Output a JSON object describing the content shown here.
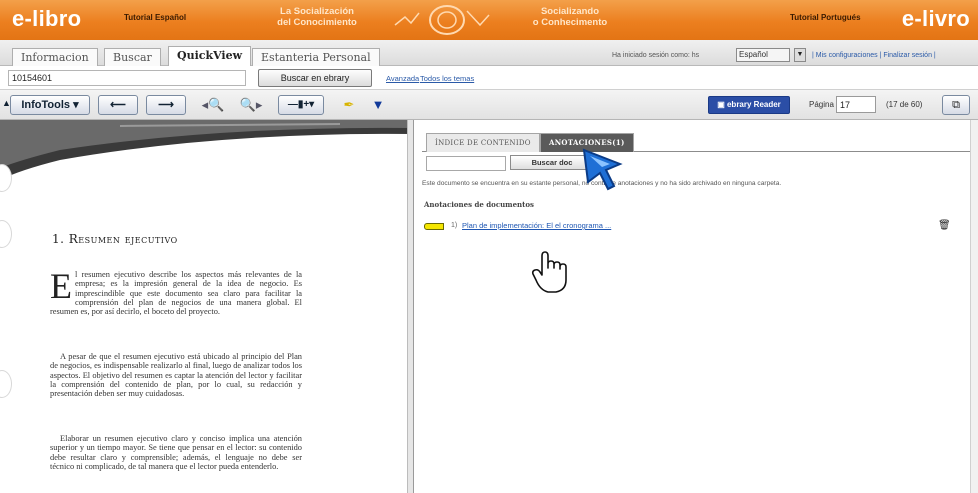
{
  "banner": {
    "brand_left": "e-libro",
    "tutorial_es": "Tutorial Español",
    "slogan_es_line1": "La Socialización",
    "slogan_es_line2": "del Conocimiento",
    "slogan_pt_line1": "Socializando",
    "slogan_pt_line2": "o Conhecimento",
    "tutorial_pt": "Tutorial Portugués",
    "brand_right": "e-livro"
  },
  "tabs": [
    {
      "label": "Informacion"
    },
    {
      "label": "Buscar"
    },
    {
      "label": "QuickView",
      "active": true
    },
    {
      "label": "Estanteria Personal"
    }
  ],
  "session": {
    "text": "Ha iniciado sesión como: hs",
    "language": "Español",
    "links": "| Mis configuraciones | Finalizar sesión |"
  },
  "search": {
    "value": "10154601",
    "button": "Buscar en ebrary",
    "advanced": "Avanzada",
    "all_topics": "Todos los temas"
  },
  "toolbar": {
    "infotools": "InfoTools",
    "reader": "ebrary Reader",
    "page_label": "Página",
    "page_value": "17",
    "page_count": "(17 de 60)"
  },
  "document": {
    "heading": "1. Resumen ejecutivo",
    "dropcap": "E",
    "p1": "l resumen ejecutivo describe los aspectos más relevantes de la empresa; es la impresión general de la idea de negocio. Es imprescindible que este documento sea claro para facilitar la comprensión del plan de negocios de una manera global. El resumen es, por así decirlo, el boceto del proyecto.",
    "p2": "A pesar de que el resumen ejecutivo está ubicado al principio del Plan de negocios, es indispensable realizarlo al final, luego de analizar todos los aspectos. El objetivo del resumen es captar la atención del lector y facilitar la comprensión del contenido de plan, por lo cual, su redacción y presentación deben ser muy cuidadosas.",
    "p3": "Elaborar un resumen ejecutivo claro y conciso implica una atención superior y un tiempo mayor. Se tiene que pensar en el lector: su contenido debe resultar claro y comprensible; además, el lenguaje no debe ser técnico ni complicado, de tal manera que el lector pueda entenderlo."
  },
  "annotations": {
    "tab_index": "ÍNDICE DE CONTENIDO",
    "tab_annotations": "ANOTACIONES(1)",
    "search_button": "Buscar doc",
    "note": "Este documento se encuentra en su estante personal, no contiene anotaciones y no ha sido archivado en ninguna carpeta.",
    "heading": "Anotaciones de documentos",
    "item_number": "1)",
    "item_link": "Plan de implementación: El el cronograma ..."
  },
  "colors": {
    "banner_orange": "#ec7f1f",
    "reader_blue": "#2b4ea6",
    "link_blue": "#1f57b3",
    "highlight_yellow": "#f5e600"
  }
}
